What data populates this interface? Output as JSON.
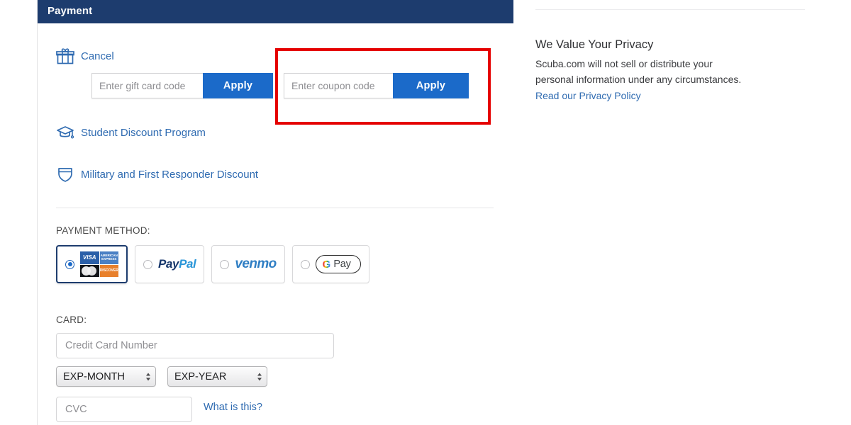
{
  "panel": {
    "header_title": "Payment"
  },
  "discounts": [
    {
      "id": "giftcard",
      "icon": "gift-icon",
      "label": "Cancel"
    },
    {
      "id": "student",
      "icon": "graduation-cap-icon",
      "label": "Student Discount Program"
    },
    {
      "id": "military",
      "icon": "shield-icon",
      "label": "Military and First Responder Discount"
    }
  ],
  "giftcard_form": {
    "placeholder": "Enter gift card code",
    "value": "",
    "apply_label": "Apply"
  },
  "coupon_form": {
    "placeholder": "Enter coupon code",
    "value": "",
    "apply_label": "Apply"
  },
  "annotation": {
    "color": "#e50000",
    "target": "coupon-code-entry"
  },
  "payment_method": {
    "label": "PAYMENT METHOD:",
    "selected": "credit-card",
    "options": [
      {
        "id": "credit-card",
        "label": "Credit Card",
        "selected": true,
        "brands": [
          "VISA",
          "AMERICAN EXPRESS",
          "mastercard",
          "DISCOVER"
        ]
      },
      {
        "id": "paypal",
        "label": "PayPal",
        "selected": false,
        "logo_part_1": "Pay",
        "logo_part_2": "Pal"
      },
      {
        "id": "venmo",
        "label": "venmo",
        "selected": false
      },
      {
        "id": "gpay",
        "label": "G Pay",
        "selected": false,
        "g_mark": "G",
        "pay_text": "Pay"
      }
    ]
  },
  "card_section": {
    "label": "CARD:",
    "number_placeholder": "Credit Card Number",
    "number_value": "",
    "exp_month": "EXP-MONTH",
    "exp_year": "EXP-YEAR",
    "cvc_placeholder": "CVC",
    "cvc_value": "",
    "help_link": "What is this?"
  },
  "privacy": {
    "title": "We Value Your Privacy",
    "line_1": "Scuba.com will not sell or distribute your",
    "line_2": "personal information under any circumstances.",
    "link": "Read our Privacy Policy"
  },
  "colors": {
    "header_navy": "#1d3c6e",
    "apply_blue": "#1b6ac9",
    "link_blue": "#2f6bb1",
    "annotation_red": "#e50000"
  }
}
